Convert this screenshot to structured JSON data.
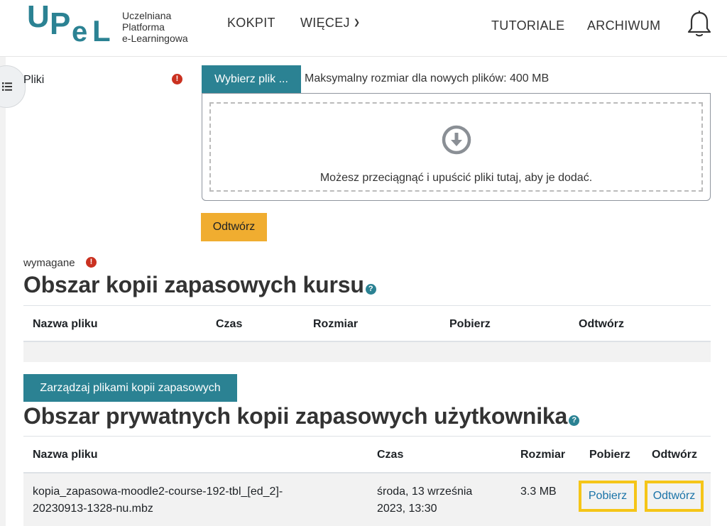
{
  "header": {
    "logo_lines": [
      "Uczelniana",
      "Platforma",
      "e-Learningowa"
    ],
    "nav": {
      "kokpit": "KOKPIT",
      "wiecej": "WIĘCEJ",
      "tutoriale": "TUTORIALE",
      "archiwum": "ARCHIWUM"
    }
  },
  "upload": {
    "label": "Pliki",
    "choose_button": "Wybierz plik ...",
    "max_size": "Maksymalny rozmiar dla nowych plików: 400 MB",
    "drop_hint": "Możesz przeciągnąć i upuścić pliki tutaj, aby je dodać.",
    "restore_button": "Odtwórz",
    "required_label": "wymagane"
  },
  "course_backups": {
    "title": "Obszar kopii zapasowych kursu",
    "columns": [
      "Nazwa pliku",
      "Czas",
      "Rozmiar",
      "Pobierz",
      "Odtwórz"
    ],
    "manage_button": "Zarządzaj plikami kopii zapasowych"
  },
  "user_backups": {
    "title": "Obszar prywatnych kopii zapasowych użytkownika",
    "columns": [
      "Nazwa pliku",
      "Czas",
      "Rozmiar",
      "Pobierz",
      "Odtwórz"
    ],
    "rows": [
      {
        "filename_line1": "kopia_zapasowa-moodle2-course-192-tbl_[ed_2]-",
        "filename_line2": "20230913-1328-nu.mbz",
        "time_line1": "środa, 13 września",
        "time_line2": "2023, 13:30",
        "size": "3.3 MB",
        "download": "Pobierz",
        "restore": "Odtwórz"
      }
    ]
  },
  "colors": {
    "accent": "#2b8293",
    "restore_button": "#f0ad30",
    "highlight": "#f5c518",
    "required": "#ca3120"
  }
}
